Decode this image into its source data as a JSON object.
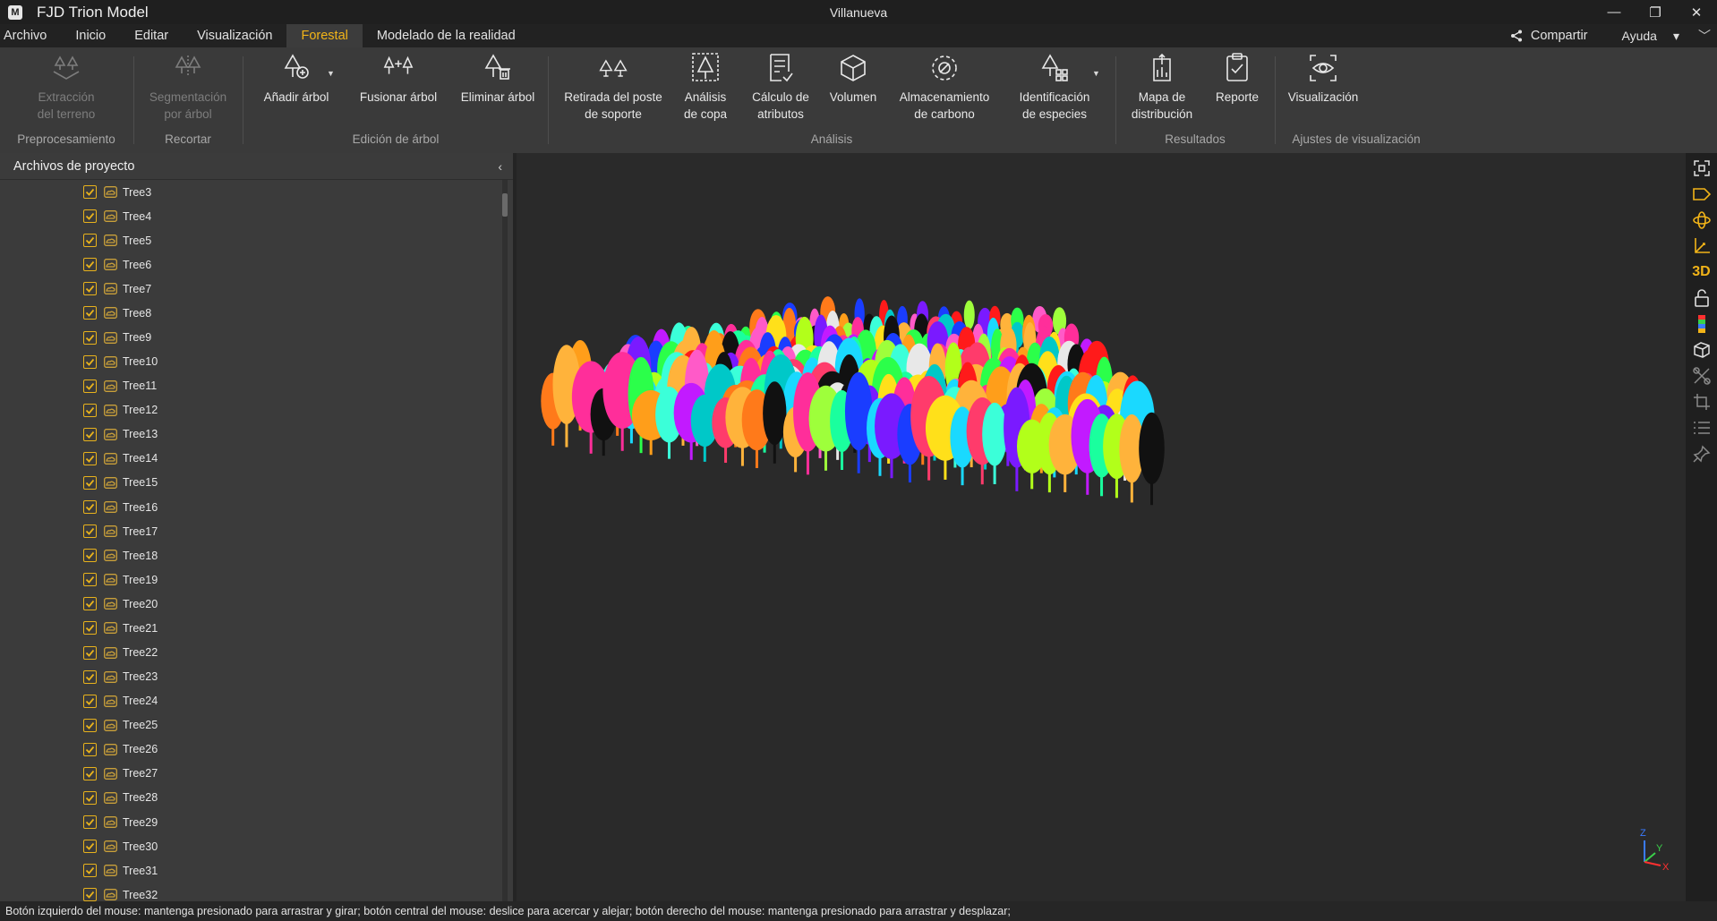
{
  "app": {
    "name": "FJD Trion Model",
    "logo": "M",
    "document_title": "Villanueva"
  },
  "window_controls": {
    "minimize": "—",
    "restore": "❐",
    "close": "✕"
  },
  "menu": {
    "items": [
      "Archivo",
      "Inicio",
      "Editar",
      "Visualización",
      "Forestal",
      "Modelado de la realidad"
    ],
    "active": "Forestal",
    "share_label": "Compartir",
    "help_label": "Ayuda",
    "help_arrow": "▾",
    "collapse_chevron": "﹀"
  },
  "ribbon": {
    "groups": {
      "preprocess": {
        "label": "Preprocesamiento",
        "buttons": [
          {
            "label_1": "Extracción",
            "label_2": "del terreno",
            "icon": "terrain-extraction-icon",
            "disabled": true
          }
        ]
      },
      "clip": {
        "label": "Recortar",
        "buttons": [
          {
            "label_1": "Segmentación",
            "label_2": "por árbol",
            "icon": "tree-segmentation-icon",
            "disabled": true
          }
        ]
      },
      "tree_edit": {
        "label": "Edición de árbol",
        "buttons": [
          {
            "label_1": "Añadir árbol",
            "icon": "add-tree-icon"
          },
          {
            "label_1": "Fusionar árbol",
            "icon": "merge-tree-icon"
          },
          {
            "label_1": "Eliminar árbol",
            "icon": "delete-tree-icon"
          }
        ]
      },
      "analysis": {
        "label": "Análisis",
        "buttons": [
          {
            "label_1": "Retirada del poste",
            "label_2": "de soporte",
            "icon": "support-pole-removal-icon"
          },
          {
            "label_1": "Análisis",
            "label_2": "de copa",
            "icon": "crown-analysis-icon"
          },
          {
            "label_1": "Cálculo de",
            "label_2": "atributos",
            "icon": "attribute-calc-icon"
          },
          {
            "label_1": "Volumen",
            "icon": "volume-cube-icon"
          },
          {
            "label_1": "Almacenamiento",
            "label_2": "de carbono",
            "icon": "carbon-storage-icon"
          },
          {
            "label_1": "Identificación",
            "label_2": "de especies",
            "icon": "species-id-icon"
          }
        ]
      },
      "results": {
        "label": "Resultados",
        "buttons": [
          {
            "label_1": "Mapa de",
            "label_2": "distribución",
            "icon": "distribution-map-icon"
          },
          {
            "label_1": "Reporte",
            "icon": "report-clipboard-icon"
          }
        ]
      },
      "display": {
        "label": "Ajustes de visualización",
        "buttons": [
          {
            "label_1": "Visualización",
            "icon": "visualization-eye-icon"
          }
        ]
      }
    }
  },
  "left_panel": {
    "title": "Archivos de proyecto",
    "collapse_glyph": "‹",
    "items": [
      "Tree3",
      "Tree4",
      "Tree5",
      "Tree6",
      "Tree7",
      "Tree8",
      "Tree9",
      "Tree10",
      "Tree11",
      "Tree12",
      "Tree13",
      "Tree14",
      "Tree15",
      "Tree16",
      "Tree17",
      "Tree18",
      "Tree19",
      "Tree20",
      "Tree21",
      "Tree22",
      "Tree23",
      "Tree24",
      "Tree25",
      "Tree26",
      "Tree27",
      "Tree28",
      "Tree29",
      "Tree30",
      "Tree31",
      "Tree32"
    ],
    "checked": true
  },
  "viewport": {
    "axis_labels": {
      "z": "Z",
      "y": "Y",
      "x": "X"
    }
  },
  "right_toolbar": {
    "buttons": [
      "fit-view-icon",
      "perspective-icon",
      "orbit-icon",
      "axis-view-icon",
      "3d-label",
      "lock-icon",
      "color-bar-icon",
      "cube-view-icon",
      "tools-icon",
      "crop-icon",
      "list-icon",
      "pin-icon"
    ],
    "label_3d": "3D"
  },
  "status": {
    "text": "Botón izquierdo del mouse: mantenga presionado para arrastrar y girar; botón central del mouse: deslice para acercar y alejar; botón derecho del mouse: mantenga presionado para arrastrar y desplazar;"
  },
  "colors": {
    "accent": "#f2b418",
    "background": "#2a2a2a",
    "panel": "#3b3b3b",
    "ribbon": "#3a3a3a"
  }
}
